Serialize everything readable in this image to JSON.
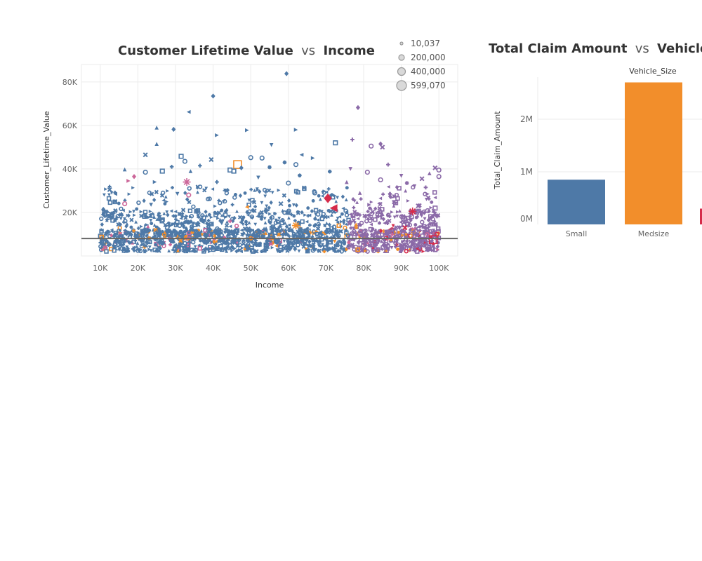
{
  "colors": {
    "blue": "#4e79a7",
    "purple": "#8b6aa8",
    "orange": "#f28e2b",
    "red": "#d62b4a",
    "pink": "#cc6699",
    "grid": "#ebebeb",
    "axis_text": "#666666",
    "ref_line": "#666666",
    "title": "#333333"
  },
  "chart_data": [
    {
      "type": "scatter",
      "title": "Customer Lifetime Value",
      "title_connector": "vs",
      "title_suffix": "Income",
      "xlabel": "Income",
      "ylabel": "Customer_Lifetime_Value",
      "xlim": [
        5000,
        105000
      ],
      "ylim": [
        0,
        88000
      ],
      "x_ticks": [
        10000,
        20000,
        30000,
        40000,
        50000,
        60000,
        70000,
        80000,
        90000,
        100000
      ],
      "x_tick_labels": [
        "10K",
        "20K",
        "30K",
        "40K",
        "50K",
        "60K",
        "70K",
        "80K",
        "90K",
        "100K"
      ],
      "y_ticks": [
        20000,
        40000,
        60000,
        80000
      ],
      "y_tick_labels": [
        "20K",
        "40K",
        "60K",
        "80K"
      ],
      "grid": true,
      "reference_line_y": 8000,
      "size_legend": {
        "placement": "top-right",
        "entries": [
          {
            "label": "10,037",
            "value": 10037
          },
          {
            "label": "200,000",
            "value": 200000
          },
          {
            "label": "400,000",
            "value": 400000
          },
          {
            "label": "599,070",
            "value": 599070
          }
        ]
      },
      "points": [
        {
          "x": 59500,
          "y": 83800,
          "s": "diamond",
          "c": "blue"
        },
        {
          "x": 40000,
          "y": 73500,
          "s": "diamond",
          "c": "blue"
        },
        {
          "x": 33500,
          "y": 66200,
          "s": "triangle-left",
          "c": "blue"
        },
        {
          "x": 78500,
          "y": 68200,
          "s": "diamond",
          "c": "purple"
        },
        {
          "x": 25000,
          "y": 59000,
          "s": "triangle",
          "c": "blue"
        },
        {
          "x": 29500,
          "y": 58200,
          "s": "diamond",
          "c": "blue"
        },
        {
          "x": 49000,
          "y": 57800,
          "s": "triangle-right",
          "c": "blue"
        },
        {
          "x": 62000,
          "y": 58000,
          "s": "triangle-right",
          "c": "blue"
        },
        {
          "x": 41000,
          "y": 55500,
          "s": "triangle-right",
          "c": "blue"
        },
        {
          "x": 77000,
          "y": 53500,
          "s": "cross",
          "c": "purple"
        },
        {
          "x": 72500,
          "y": 52000,
          "s": "square",
          "c": "blue"
        },
        {
          "x": 82000,
          "y": 50500,
          "s": "circle",
          "c": "purple"
        },
        {
          "x": 84500,
          "y": 51500,
          "s": "diamond",
          "c": "purple"
        },
        {
          "x": 85000,
          "y": 50000,
          "s": "x",
          "c": "purple"
        },
        {
          "x": 25000,
          "y": 51500,
          "s": "triangle",
          "c": "blue"
        },
        {
          "x": 55500,
          "y": 51000,
          "s": "triangle-down",
          "c": "blue"
        },
        {
          "x": 12500,
          "y": 30500,
          "s": "x",
          "c": "blue"
        },
        {
          "x": 22000,
          "y": 46500,
          "s": "x",
          "c": "blue"
        },
        {
          "x": 31500,
          "y": 45800,
          "s": "square",
          "c": "blue"
        },
        {
          "x": 39500,
          "y": 44300,
          "s": "x",
          "c": "blue"
        },
        {
          "x": 50000,
          "y": 45200,
          "s": "circle",
          "c": "blue"
        },
        {
          "x": 53000,
          "y": 45000,
          "s": "circle",
          "c": "blue"
        },
        {
          "x": 63500,
          "y": 46500,
          "s": "triangle-left",
          "c": "blue"
        },
        {
          "x": 66500,
          "y": 45000,
          "s": "triangle-right",
          "c": "blue"
        },
        {
          "x": 32500,
          "y": 43500,
          "s": "circle",
          "c": "blue"
        },
        {
          "x": 59000,
          "y": 43000,
          "s": "asterisk",
          "c": "blue"
        },
        {
          "x": 46500,
          "y": 42000,
          "s": "square",
          "c": "orange",
          "big": true
        },
        {
          "x": 47500,
          "y": 40500,
          "s": "diamond",
          "c": "blue"
        },
        {
          "x": 29000,
          "y": 41000,
          "s": "cross",
          "c": "blue"
        },
        {
          "x": 36500,
          "y": 41500,
          "s": "cross",
          "c": "blue"
        },
        {
          "x": 55000,
          "y": 40800,
          "s": "asterisk",
          "c": "blue"
        },
        {
          "x": 62000,
          "y": 42000,
          "s": "circle",
          "c": "blue"
        },
        {
          "x": 76500,
          "y": 40000,
          "s": "triangle-down",
          "c": "purple"
        },
        {
          "x": 86500,
          "y": 42000,
          "s": "cross",
          "c": "purple"
        },
        {
          "x": 99000,
          "y": 40500,
          "s": "x",
          "c": "purple"
        },
        {
          "x": 100000,
          "y": 39500,
          "s": "circle",
          "c": "purple"
        },
        {
          "x": 16500,
          "y": 39800,
          "s": "triangle",
          "c": "blue"
        },
        {
          "x": 22000,
          "y": 38500,
          "s": "circle",
          "c": "blue"
        },
        {
          "x": 26500,
          "y": 39000,
          "s": "square",
          "c": "blue"
        },
        {
          "x": 34000,
          "y": 39000,
          "s": "triangle",
          "c": "blue"
        },
        {
          "x": 44500,
          "y": 39500,
          "s": "square",
          "c": "blue"
        },
        {
          "x": 45500,
          "y": 39000,
          "s": "square",
          "c": "blue"
        },
        {
          "x": 71000,
          "y": 38800,
          "s": "asterisk",
          "c": "blue"
        },
        {
          "x": 81000,
          "y": 38500,
          "s": "circle",
          "c": "purple"
        },
        {
          "x": 90000,
          "y": 36800,
          "s": "triangle-down",
          "c": "purple"
        },
        {
          "x": 97500,
          "y": 38000,
          "s": "triangle",
          "c": "purple"
        },
        {
          "x": 19000,
          "y": 36500,
          "s": "diamond",
          "c": "pink"
        },
        {
          "x": 33000,
          "y": 34000,
          "s": "asterisk",
          "c": "pink",
          "big": true
        },
        {
          "x": 52000,
          "y": 36000,
          "s": "triangle-down",
          "c": "blue"
        },
        {
          "x": 63000,
          "y": 37000,
          "s": "asterisk",
          "c": "blue"
        },
        {
          "x": 84500,
          "y": 35000,
          "s": "circle",
          "c": "purple"
        },
        {
          "x": 95500,
          "y": 35500,
          "s": "x",
          "c": "purple"
        },
        {
          "x": 100000,
          "y": 36500,
          "s": "circle",
          "c": "purple"
        },
        {
          "x": 17500,
          "y": 34500,
          "s": "triangle-right",
          "c": "pink"
        },
        {
          "x": 24500,
          "y": 34000,
          "s": "triangle-right",
          "c": "blue"
        },
        {
          "x": 41000,
          "y": 34000,
          "s": "cross",
          "c": "blue"
        },
        {
          "x": 60000,
          "y": 33500,
          "s": "circle",
          "c": "blue"
        },
        {
          "x": 75500,
          "y": 34000,
          "s": "triangle",
          "c": "purple"
        },
        {
          "x": 91500,
          "y": 33500,
          "s": "asterisk",
          "c": "purple"
        },
        {
          "x": 93500,
          "y": 32000,
          "s": "triangle-down",
          "c": "purple"
        },
        {
          "x": 96500,
          "y": 31500,
          "s": "cross",
          "c": "purple"
        },
        {
          "x": 14000,
          "y": 28500,
          "s": "triangle-left",
          "c": "blue"
        },
        {
          "x": 30500,
          "y": 28500,
          "s": "triangle-down",
          "c": "blue"
        },
        {
          "x": 33500,
          "y": 28000,
          "s": "circle",
          "c": "pink"
        },
        {
          "x": 43000,
          "y": 30000,
          "s": "triangle-left",
          "c": "blue"
        },
        {
          "x": 54000,
          "y": 29500,
          "s": "cross",
          "c": "blue"
        },
        {
          "x": 67000,
          "y": 29000,
          "s": "circle",
          "c": "blue"
        },
        {
          "x": 79000,
          "y": 29000,
          "s": "triangle",
          "c": "purple"
        },
        {
          "x": 87000,
          "y": 28500,
          "s": "diamond",
          "c": "purple"
        },
        {
          "x": 97000,
          "y": 28500,
          "s": "triangle-right",
          "c": "purple"
        },
        {
          "x": 70500,
          "y": 26500,
          "s": "diamond",
          "c": "red",
          "big": true
        },
        {
          "x": 72000,
          "y": 22000,
          "s": "triangle-left",
          "c": "red",
          "big": true
        },
        {
          "x": 93000,
          "y": 20500,
          "s": "asterisk",
          "c": "red",
          "big": true
        },
        {
          "x": 94500,
          "y": 23000,
          "s": "x",
          "c": "purple"
        },
        {
          "x": 97000,
          "y": 20800,
          "s": "circle",
          "c": "purple"
        },
        {
          "x": 99000,
          "y": 22000,
          "s": "square",
          "c": "purple"
        },
        {
          "x": 16500,
          "y": 24000,
          "s": "circle",
          "c": "pink"
        },
        {
          "x": 23500,
          "y": 23500,
          "s": "triangle-down",
          "c": "blue"
        },
        {
          "x": 49000,
          "y": 22500,
          "s": "triangle-left",
          "c": "orange"
        },
        {
          "x": 58000,
          "y": 24000,
          "s": "x",
          "c": "blue"
        },
        {
          "x": 81500,
          "y": 23500,
          "s": "triangle-right",
          "c": "purple"
        },
        {
          "x": 88500,
          "y": 24500,
          "s": "square",
          "c": "purple"
        },
        {
          "x": 44500,
          "y": 16000,
          "s": "cross",
          "c": "pink"
        },
        {
          "x": 62000,
          "y": 14000,
          "s": "asterisk",
          "c": "orange",
          "big": true
        },
        {
          "x": 78000,
          "y": 14500,
          "s": "triangle",
          "c": "orange"
        },
        {
          "x": 91000,
          "y": 13000,
          "s": "x",
          "c": "red"
        },
        {
          "x": 98500,
          "y": 7500,
          "s": "square",
          "c": "red",
          "big": true
        },
        {
          "x": 99500,
          "y": 10000,
          "s": "circle",
          "c": "red"
        }
      ]
    },
    {
      "type": "bar",
      "title": "Total Claim Amount",
      "title_connector": "vs",
      "title_suffix": "Vehicle Si",
      "column_header": "Vehicle_Size",
      "xlabel": "",
      "ylabel": "Total_Claim_Amount",
      "categories": [
        "Small",
        "Medsize"
      ],
      "values": [
        850000,
        2700000
      ],
      "bar_colors": [
        "#4e79a7",
        "#f28e2b"
      ],
      "partial_bar_color": "#d62b4a",
      "partial_bar_value": 300000,
      "ylim": [
        0,
        2800000
      ],
      "y_ticks": [
        0,
        1000000,
        2000000
      ],
      "y_tick_labels": [
        "0M",
        "1M",
        "2M"
      ],
      "grid": true
    }
  ]
}
